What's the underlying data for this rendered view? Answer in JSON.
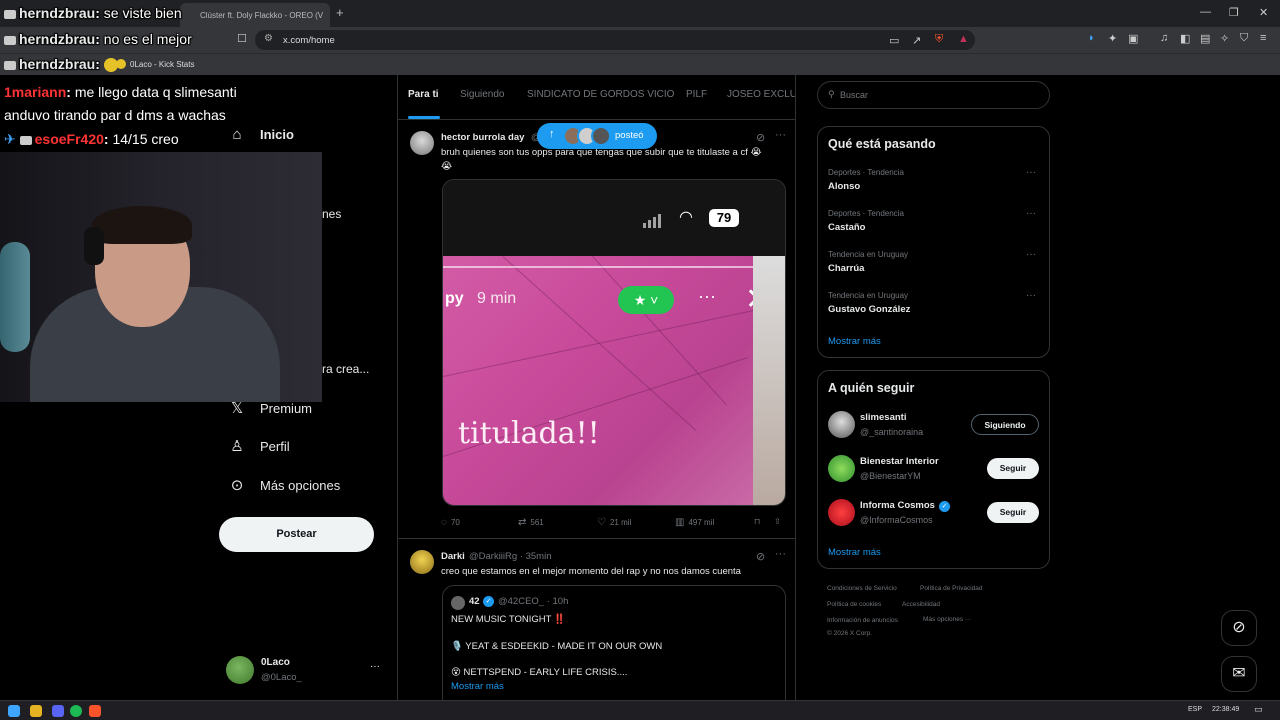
{
  "browser": {
    "tab_title": "Clúster ft. Doly Flackko - OREO (V",
    "new_tab": "+",
    "url": "x.com/home",
    "bookmark": "0Laco - Kick Stats",
    "win_min": "—",
    "win_max": "❐",
    "win_close": "✕"
  },
  "chat": [
    {
      "user": "herndzbrau",
      "sep": ":",
      "msg": "se viste bien"
    },
    {
      "user": "herndzbrau",
      "sep": ":",
      "msg": "no es el mejor"
    },
    {
      "user": "herndzbrau",
      "sep": ":",
      "msg": ""
    },
    {
      "user": "1mariann",
      "sep": ":",
      "msg": "me llego data q slimesanti"
    },
    {
      "msg": "anduvo tirando par d dms a wachas"
    },
    {
      "user": "esoeFr420",
      "sep": ":",
      "msg": "14/15 creo"
    }
  ],
  "nav": {
    "home": "Inicio",
    "partial_lists": "nes",
    "partial_grok": "ra crea...",
    "premium": "Premium",
    "profile": "Perfil",
    "more": "Más opciones",
    "post_button": "Postear",
    "account_name": "0Laco",
    "account_handle": "@0Laco_",
    "account_more": "···"
  },
  "feed": {
    "tabs": [
      "Para ti",
      "Siguiendo",
      "SINDICATO DE GORDOS VICIO",
      "PILF",
      "JOSEO EXCLUSI"
    ],
    "new_posts": "posteó",
    "posts": [
      {
        "name": "hector burrola day",
        "handle": "@",
        "text": "bruh quienes son tus opps para que tengas que subir que te titulaste a cf 😭",
        "text2": "😭",
        "media": {
          "battery": "79",
          "time": "9 min",
          "time_prefix": "py",
          "caption": "titulada!!"
        },
        "replies": "70",
        "reposts": "561",
        "likes": "21 mil",
        "views": "497 mil"
      },
      {
        "name": "Darki",
        "handle": "@DarkiiiRg · 35min",
        "text": "creo que estamos en el mejor momento del rap y no nos damos cuenta",
        "quote": {
          "name": "42",
          "handle": "@42CEO_ · 10h",
          "line1": "NEW MUSIC TONIGHT ‼️",
          "line2": "🎙️ YEAT & ESDEEKID - MADE IT ON OUR OWN",
          "line3": "😵 NETTSPEND - EARLY LIFE CRISIS....",
          "more": "Mostrar más"
        }
      }
    ]
  },
  "right": {
    "search_placeholder": "Buscar",
    "trends_title": "Qué está pasando",
    "trends": [
      {
        "category": "Deportes · Tendencia",
        "name": "Alonso"
      },
      {
        "category": "Deportes · Tendencia",
        "name": "Castaño"
      },
      {
        "category": "Tendencia en Uruguay",
        "name": "Charrúa"
      },
      {
        "category": "Tendencia en Uruguay",
        "name": "Gustavo González"
      }
    ],
    "trends_more": "Mostrar más",
    "follow_title": "A quién seguir",
    "follow": [
      {
        "name": "slimesanti",
        "handle": "@_santinoraina",
        "button": "Siguiendo"
      },
      {
        "name": "Bienestar Interior",
        "handle": "@BienestarYM",
        "button": "Seguir"
      },
      {
        "name": "Informa Cosmos",
        "handle": "@InformaCosmos",
        "button": "Seguir"
      }
    ],
    "follow_more": "Mostrar más",
    "footer": [
      "Condiciones de Servicio",
      "Política de Privacidad",
      "Política de cookies",
      "Accesibilidad",
      "Información de anuncios",
      "Más opciones ···",
      "© 2026 X Corp."
    ]
  },
  "taskbar": {
    "lang": "ESP",
    "time": "22:38:49"
  },
  "colors": {
    "accent": "#1d9bf0",
    "background": "#000000",
    "border": "#2f3336",
    "muted": "#71767b",
    "chat_red": "#ff3333"
  }
}
